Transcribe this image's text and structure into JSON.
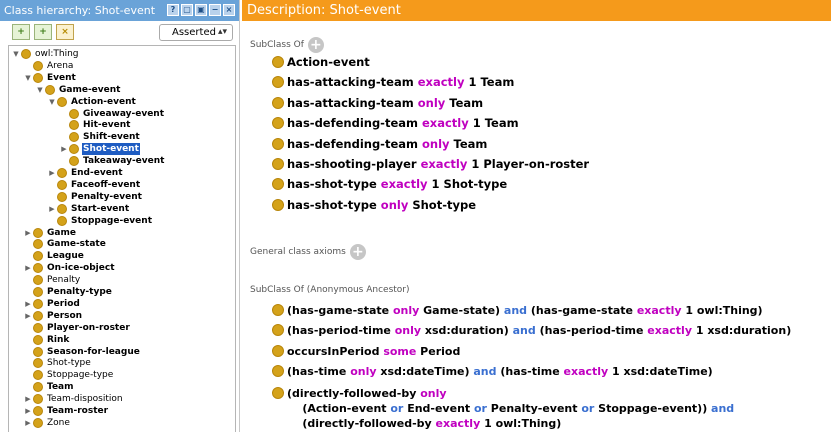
{
  "left_panel": {
    "title": "Class hierarchy: Shot-event",
    "header_icons": [
      "?",
      "▢",
      "▣",
      "−",
      "×"
    ],
    "toolbar": {
      "add_subclass_label": "+",
      "add_sibling_label": "+",
      "delete_label": "×",
      "mode_select": "Asserted",
      "mode_arrow": "▴▾"
    },
    "tree": [
      {
        "label": "owl:Thing",
        "depth": 0,
        "expand": "down",
        "bold": false
      },
      {
        "label": "Arena",
        "depth": 1,
        "expand": "",
        "bold": false
      },
      {
        "label": "Event",
        "depth": 1,
        "expand": "down",
        "bold": true
      },
      {
        "label": "Game-event",
        "depth": 2,
        "expand": "down",
        "bold": true
      },
      {
        "label": "Action-event",
        "depth": 3,
        "expand": "down",
        "bold": true
      },
      {
        "label": "Giveaway-event",
        "depth": 4,
        "expand": "",
        "bold": true
      },
      {
        "label": "Hit-event",
        "depth": 4,
        "expand": "",
        "bold": true
      },
      {
        "label": "Shift-event",
        "depth": 4,
        "expand": "",
        "bold": true
      },
      {
        "label": "Shot-event",
        "depth": 4,
        "expand": "right",
        "bold": true,
        "selected": true
      },
      {
        "label": "Takeaway-event",
        "depth": 4,
        "expand": "",
        "bold": true
      },
      {
        "label": "End-event",
        "depth": 3,
        "expand": "right",
        "bold": true
      },
      {
        "label": "Faceoff-event",
        "depth": 3,
        "expand": "",
        "bold": true
      },
      {
        "label": "Penalty-event",
        "depth": 3,
        "expand": "",
        "bold": true
      },
      {
        "label": "Start-event",
        "depth": 3,
        "expand": "right",
        "bold": true
      },
      {
        "label": "Stoppage-event",
        "depth": 3,
        "expand": "",
        "bold": true
      },
      {
        "label": "Game",
        "depth": 1,
        "expand": "right",
        "bold": true
      },
      {
        "label": "Game-state",
        "depth": 1,
        "expand": "",
        "bold": true
      },
      {
        "label": "League",
        "depth": 1,
        "expand": "",
        "bold": true
      },
      {
        "label": "On-ice-object",
        "depth": 1,
        "expand": "right",
        "bold": true
      },
      {
        "label": "Penalty",
        "depth": 1,
        "expand": "",
        "bold": false
      },
      {
        "label": "Penalty-type",
        "depth": 1,
        "expand": "",
        "bold": true
      },
      {
        "label": "Period",
        "depth": 1,
        "expand": "right",
        "bold": true
      },
      {
        "label": "Person",
        "depth": 1,
        "expand": "right",
        "bold": true
      },
      {
        "label": "Player-on-roster",
        "depth": 1,
        "expand": "",
        "bold": true
      },
      {
        "label": "Rink",
        "depth": 1,
        "expand": "",
        "bold": true
      },
      {
        "label": "Season-for-league",
        "depth": 1,
        "expand": "",
        "bold": true
      },
      {
        "label": "Shot-type",
        "depth": 1,
        "expand": "",
        "bold": false
      },
      {
        "label": "Stoppage-type",
        "depth": 1,
        "expand": "",
        "bold": false
      },
      {
        "label": "Team",
        "depth": 1,
        "expand": "",
        "bold": true
      },
      {
        "label": "Team-disposition",
        "depth": 1,
        "expand": "right",
        "bold": false
      },
      {
        "label": "Team-roster",
        "depth": 1,
        "expand": "right",
        "bold": true
      },
      {
        "label": "Zone",
        "depth": 1,
        "expand": "right",
        "bold": false
      }
    ]
  },
  "right_panel": {
    "title": "Description: Shot-event",
    "subclass_of_label": "SubClass Of",
    "general_axioms_label": "General class axioms",
    "anon_ancestor_label": "SubClass Of (Anonymous Ancestor)",
    "subclass_of": [
      [
        {
          "t": "Action-event",
          "c": ""
        }
      ],
      [
        {
          "t": "has-attacking-team ",
          "c": ""
        },
        {
          "t": "exactly",
          "c": "kw"
        },
        {
          "t": " 1 Team",
          "c": ""
        }
      ],
      [
        {
          "t": "has-attacking-team ",
          "c": ""
        },
        {
          "t": "only",
          "c": "kw"
        },
        {
          "t": " Team",
          "c": ""
        }
      ],
      [
        {
          "t": "has-defending-team ",
          "c": ""
        },
        {
          "t": "exactly",
          "c": "kw"
        },
        {
          "t": " 1 Team",
          "c": ""
        }
      ],
      [
        {
          "t": "has-defending-team ",
          "c": ""
        },
        {
          "t": "only",
          "c": "kw"
        },
        {
          "t": " Team",
          "c": ""
        }
      ],
      [
        {
          "t": "has-shooting-player ",
          "c": ""
        },
        {
          "t": "exactly",
          "c": "kw"
        },
        {
          "t": " 1 Player-on-roster",
          "c": ""
        }
      ],
      [
        {
          "t": "has-shot-type ",
          "c": ""
        },
        {
          "t": "exactly",
          "c": "kw"
        },
        {
          "t": " 1 Shot-type",
          "c": ""
        }
      ],
      [
        {
          "t": "has-shot-type ",
          "c": ""
        },
        {
          "t": "only",
          "c": "kw"
        },
        {
          "t": " Shot-type",
          "c": ""
        }
      ]
    ],
    "anon_ancestors": [
      [
        [
          {
            "t": "(has-game-state ",
            "c": ""
          },
          {
            "t": "only",
            "c": "kw"
          },
          {
            "t": " Game-state) ",
            "c": ""
          },
          {
            "t": "and",
            "c": "kw2"
          },
          {
            "t": " (has-game-state ",
            "c": ""
          },
          {
            "t": "exactly",
            "c": "kw"
          },
          {
            "t": " 1 owl:Thing)",
            "c": ""
          }
        ]
      ],
      [
        [
          {
            "t": "(has-period-time ",
            "c": ""
          },
          {
            "t": "only",
            "c": "kw"
          },
          {
            "t": " xsd:duration) ",
            "c": ""
          },
          {
            "t": "and",
            "c": "kw2"
          },
          {
            "t": " (has-period-time ",
            "c": ""
          },
          {
            "t": "exactly",
            "c": "kw"
          },
          {
            "t": " 1 xsd:duration)",
            "c": ""
          }
        ]
      ],
      [
        [
          {
            "t": "occursInPeriod ",
            "c": ""
          },
          {
            "t": "some",
            "c": "kw"
          },
          {
            "t": " Period",
            "c": ""
          }
        ]
      ],
      [
        [
          {
            "t": "(has-time ",
            "c": ""
          },
          {
            "t": "only",
            "c": "kw"
          },
          {
            "t": " xsd:dateTime) ",
            "c": ""
          },
          {
            "t": "and",
            "c": "kw2"
          },
          {
            "t": " (has-time ",
            "c": ""
          },
          {
            "t": "exactly",
            "c": "kw"
          },
          {
            "t": " 1 xsd:dateTime)",
            "c": ""
          }
        ]
      ],
      [
        [
          {
            "t": "(directly-followed-by ",
            "c": ""
          },
          {
            "t": "only",
            "c": "kw"
          }
        ],
        [
          {
            "t": "    (Action-event ",
            "c": ""
          },
          {
            "t": "or",
            "c": "kw2"
          },
          {
            "t": " End-event ",
            "c": ""
          },
          {
            "t": "or",
            "c": "kw2"
          },
          {
            "t": " Penalty-event ",
            "c": ""
          },
          {
            "t": "or",
            "c": "kw2"
          },
          {
            "t": " Stoppage-event)) ",
            "c": ""
          },
          {
            "t": "and",
            "c": "kw2"
          }
        ],
        [
          {
            "t": "    (directly-followed-by ",
            "c": ""
          },
          {
            "t": "exactly",
            "c": "kw"
          },
          {
            "t": " 1 owl:Thing)",
            "c": ""
          }
        ]
      ]
    ]
  },
  "colors": {
    "left_header": "#6aa3d8",
    "right_header": "#f59a1b",
    "class_dot": "#d4a21a",
    "keyword": "#c000c0",
    "connective": "#3a6fd0",
    "selection": "#1e5cc2"
  }
}
